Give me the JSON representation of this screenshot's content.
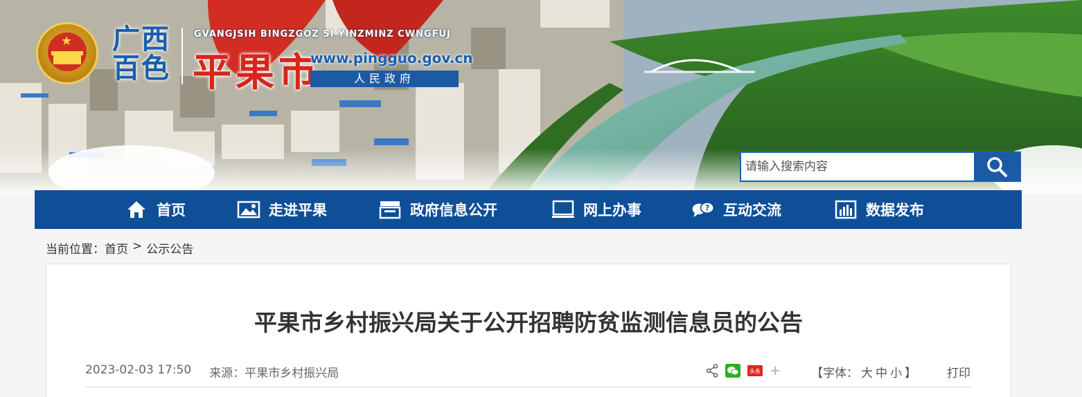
{
  "header": {
    "region": "广西\n百色",
    "zhuang_name": "GVANGJSIH BINGZGOZ SI YINZMINZ CWNGFUJ",
    "city_name": "平果市",
    "url": "www.pingguo.gov.cn",
    "gov_label": "人民政府",
    "emblem_icon": "national-emblem-icon"
  },
  "search": {
    "placeholder": "请输入搜索内容",
    "icon": "search-icon"
  },
  "nav": {
    "items": [
      {
        "label": "首页",
        "icon": "home-icon"
      },
      {
        "label": "走进平果",
        "icon": "picture-icon"
      },
      {
        "label": "政府信息公开",
        "icon": "document-icon"
      },
      {
        "label": "网上办事",
        "icon": "monitor-icon"
      },
      {
        "label": "互动交流",
        "icon": "chat-icon"
      },
      {
        "label": "数据发布",
        "icon": "bar-chart-icon"
      }
    ]
  },
  "breadcrumb": {
    "prefix": "当前位置：",
    "home": "首页",
    "separator": ">",
    "current": "公示公告"
  },
  "article": {
    "title": "平果市乡村振兴局关于公开招聘防贫监测信息员的公告",
    "date": "2023-02-03 17:50",
    "source": "来源：平果市乡村振兴局",
    "share_icons": [
      "share-icon",
      "wechat-icon",
      "toutiao-icon",
      "plus-icon"
    ],
    "toutiao_label": "头条",
    "font_label_open": "【字体：",
    "font_large": "大",
    "font_medium": "中",
    "font_small": "小",
    "font_label_close": "】",
    "print": "打印"
  },
  "colors": {
    "nav_bg": "#0f4f98",
    "brand_blue": "#1c5aa6",
    "brand_red": "#d8261b"
  }
}
